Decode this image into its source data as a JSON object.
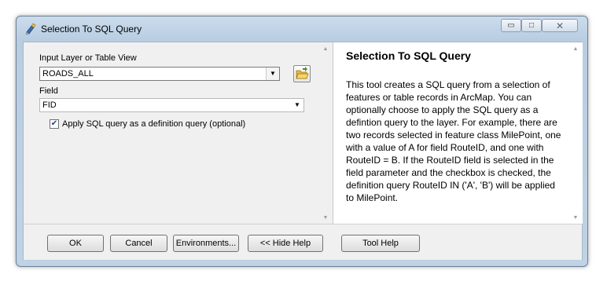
{
  "window": {
    "title": "Selection To SQL Query",
    "controls": {
      "minimize": "▭",
      "maximize": "□",
      "close": "✕"
    }
  },
  "form": {
    "input_label": "Input Layer or Table View",
    "input_value": "ROADS_ALL",
    "field_label": "Field",
    "field_value": "FID",
    "checkbox_checked": true,
    "checkbox_label": "Apply SQL query as a definition query (optional)"
  },
  "help": {
    "title": "Selection To SQL Query",
    "body": "This tool creates a SQL query from a selection of features or table records in ArcMap. You can optionally choose to apply the SQL query as a defintion query to the layer. For example, there are two records selected in feature class MilePoint, one with a value of A for field RouteID, and one with RouteID = B. If the RouteID field is selected in the field parameter and the checkbox is checked, the definition query RouteID IN ('A', 'B') will be applied to MilePoint."
  },
  "buttons": {
    "ok": "OK",
    "cancel": "Cancel",
    "environments": "Environments...",
    "hide_help": "<< Hide Help",
    "tool_help": "Tool Help"
  },
  "icons": {
    "app": "python-script-icon",
    "folder": "open-folder-icon",
    "dropdown": "chevron-down-icon"
  }
}
